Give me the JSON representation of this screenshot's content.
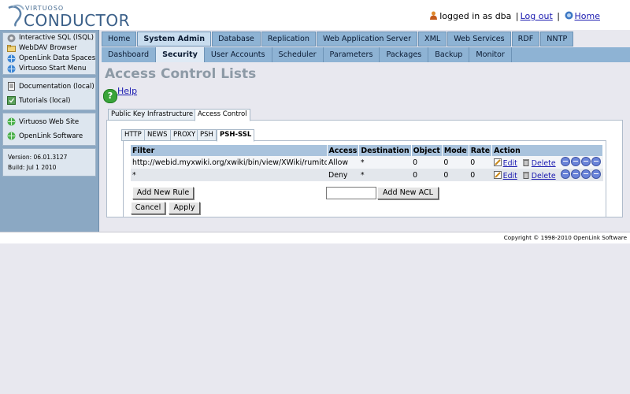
{
  "header": {
    "logo_top": "VIRTUOSO",
    "logo_main": "CONDUCTOR",
    "logged_in": "logged in as dba",
    "separator": "|",
    "logout": "Log out",
    "home": "Home"
  },
  "sidebar": {
    "group1": [
      "Interactive SQL (ISQL)",
      "WebDAV Browser",
      "OpenLink Data Spaces",
      "Virtuoso Start Menu"
    ],
    "group2": [
      "Documentation (local)",
      "Tutorials (local)"
    ],
    "group3": [
      "Virtuoso Web Site",
      "OpenLink Software"
    ],
    "version": "Version: 06.01.3127",
    "build": "Build: Jul 1 2010"
  },
  "tabs_main": [
    "Home",
    "System Admin",
    "Database",
    "Replication",
    "Web Application Server",
    "XML",
    "Web Services",
    "RDF",
    "NNTP"
  ],
  "tabs_sub": [
    "Dashboard",
    "Security",
    "User Accounts",
    "Scheduler",
    "Parameters",
    "Packages",
    "Backup",
    "Monitor"
  ],
  "page_title": "Access Control Lists",
  "help": "Help",
  "section_tabs": [
    "Public Key Infrastructure",
    "Access Control"
  ],
  "protocol_tabs": [
    "HTTP",
    "NEWS",
    "PROXY",
    "PSH",
    "PSH-SSL"
  ],
  "table": {
    "headers": [
      "Filter",
      "Access",
      "Destination",
      "Object",
      "Mode",
      "Rate",
      "Action"
    ],
    "rows": [
      {
        "filter": "http://webid.myxwiki.org/xwiki/bin/view/XWiki/rumito#me",
        "access": "Allow",
        "destination": "*",
        "object": "0",
        "mode": "0",
        "rate": "0"
      },
      {
        "filter": "*",
        "access": "Deny",
        "destination": "*",
        "object": "0",
        "mode": "0",
        "rate": "0"
      }
    ],
    "edit": "Edit",
    "delete": "Delete"
  },
  "buttons": {
    "add_rule": "Add New Rule",
    "add_acl": "Add New ACL",
    "cancel": "Cancel",
    "apply": "Apply"
  },
  "new_acl_value": "",
  "footer": "Copyright © 1998-2010 OpenLink Software"
}
